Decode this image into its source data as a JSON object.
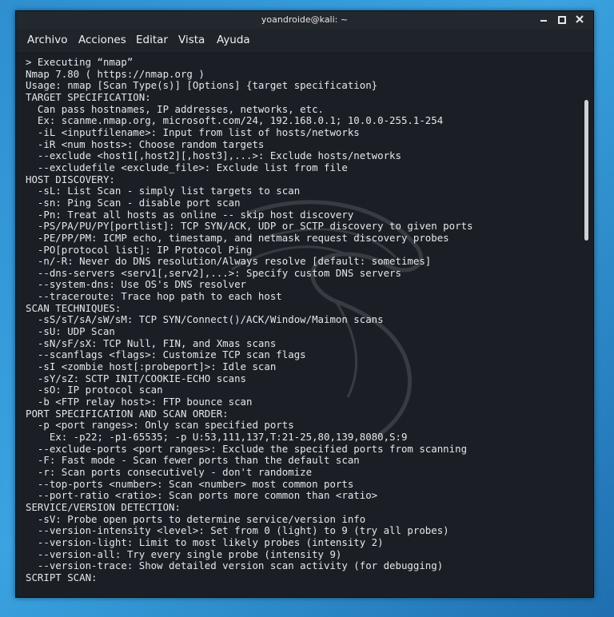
{
  "window": {
    "title": "yoandroide@kali: ~"
  },
  "menu": [
    "Archivo",
    "Acciones",
    "Editar",
    "Vista",
    "Ayuda"
  ],
  "terminal": {
    "lines": [
      "> Executing “nmap”",
      "Nmap 7.80 ( https://nmap.org )",
      "Usage: nmap [Scan Type(s)] [Options] {target specification}",
      "TARGET SPECIFICATION:",
      "  Can pass hostnames, IP addresses, networks, etc.",
      "  Ex: scanme.nmap.org, microsoft.com/24, 192.168.0.1; 10.0.0-255.1-254",
      "  -iL <inputfilename>: Input from list of hosts/networks",
      "  -iR <num hosts>: Choose random targets",
      "  --exclude <host1[,host2][,host3],...>: Exclude hosts/networks",
      "  --excludefile <exclude_file>: Exclude list from file",
      "HOST DISCOVERY:",
      "  -sL: List Scan - simply list targets to scan",
      "  -sn: Ping Scan - disable port scan",
      "  -Pn: Treat all hosts as online -- skip host discovery",
      "  -PS/PA/PU/PY[portlist]: TCP SYN/ACK, UDP or SCTP discovery to given ports",
      "  -PE/PP/PM: ICMP echo, timestamp, and netmask request discovery probes",
      "  -PO[protocol list]: IP Protocol Ping",
      "  -n/-R: Never do DNS resolution/Always resolve [default: sometimes]",
      "  --dns-servers <serv1[,serv2],...>: Specify custom DNS servers",
      "  --system-dns: Use OS's DNS resolver",
      "  --traceroute: Trace hop path to each host",
      "SCAN TECHNIQUES:",
      "  -sS/sT/sA/sW/sM: TCP SYN/Connect()/ACK/Window/Maimon scans",
      "  -sU: UDP Scan",
      "  -sN/sF/sX: TCP Null, FIN, and Xmas scans",
      "  --scanflags <flags>: Customize TCP scan flags",
      "  -sI <zombie host[:probeport]>: Idle scan",
      "  -sY/sZ: SCTP INIT/COOKIE-ECHO scans",
      "  -sO: IP protocol scan",
      "  -b <FTP relay host>: FTP bounce scan",
      "PORT SPECIFICATION AND SCAN ORDER:",
      "  -p <port ranges>: Only scan specified ports",
      "    Ex: -p22; -p1-65535; -p U:53,111,137,T:21-25,80,139,8080,S:9",
      "  --exclude-ports <port ranges>: Exclude the specified ports from scanning",
      "  -F: Fast mode - Scan fewer ports than the default scan",
      "  -r: Scan ports consecutively - don't randomize",
      "  --top-ports <number>: Scan <number> most common ports",
      "  --port-ratio <ratio>: Scan ports more common than <ratio>",
      "SERVICE/VERSION DETECTION:",
      "  -sV: Probe open ports to determine service/version info",
      "  --version-intensity <level>: Set from 0 (light) to 9 (try all probes)",
      "  --version-light: Limit to most likely probes (intensity 2)",
      "  --version-all: Try every single probe (intensity 9)",
      "  --version-trace: Show detailed version scan activity (for debugging)",
      "SCRIPT SCAN:"
    ]
  }
}
